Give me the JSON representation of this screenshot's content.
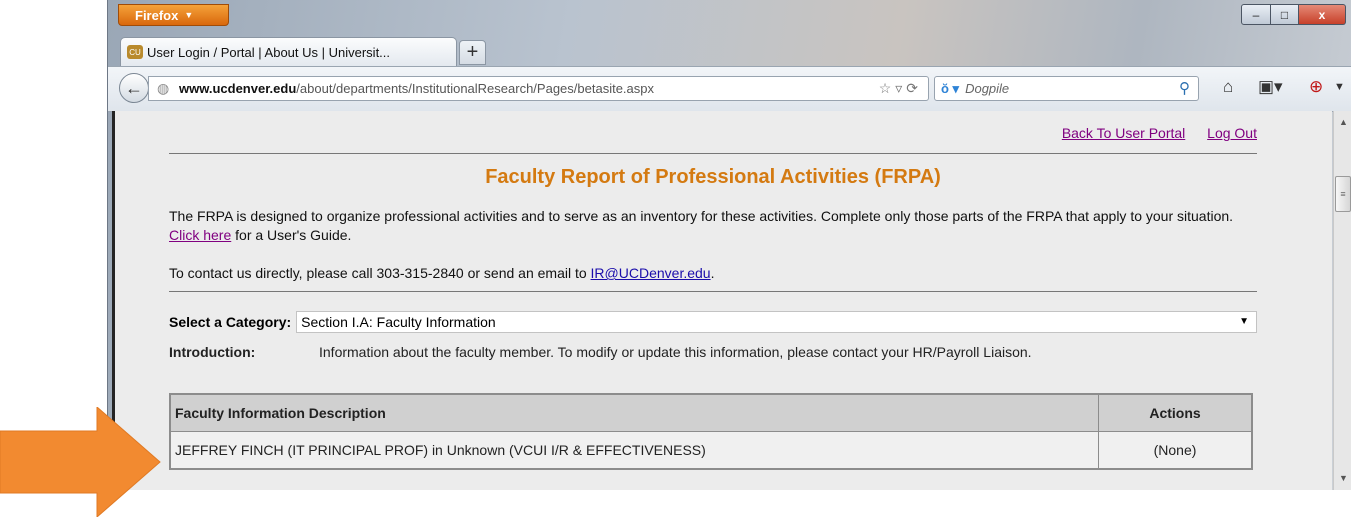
{
  "browser": {
    "menu_label": "Firefox",
    "tab_title": "User Login / Portal | About Us | Universit...",
    "new_tab": "+",
    "url_host": "www.ucdenver.edu",
    "url_path": "/about/departments/InstitutionalResearch/Pages/betasite.aspx",
    "search_engine": "Dogpile",
    "window_controls": {
      "minimize": "–",
      "maximize": "□",
      "close": "x"
    }
  },
  "page": {
    "back_to_portal": "Back To User Portal",
    "log_out": "Log Out",
    "title": "Faculty Report of Professional Activities (FRPA)",
    "intro_text": "The FRPA is designed to organize professional activities and to serve as an inventory for these activities.  Complete only those parts of the FRPA that apply to your situation.  ",
    "users_guide_link": "Click here",
    "users_guide_suffix": " for a User's Guide.",
    "contact_text": "To contact us directly, please call 303-315-2840 or send an email to ",
    "contact_email": "IR@UCDenver.edu",
    "contact_suffix": ".",
    "category_label": "Select a Category:",
    "category_value": "Section I.A: Faculty Information",
    "introduction_label": "Introduction:",
    "introduction_text": "Information about the faculty member. To modify or update this information, please contact your HR/Payroll Liaison.",
    "table": {
      "headers": [
        "Faculty Information Description",
        "Actions"
      ],
      "rows": [
        [
          "JEFFREY FINCH (IT PRINCIPAL PROF) in Unknown (VCUI I/R & EFFECTIVENESS)",
          "(None)"
        ]
      ]
    }
  },
  "annotation": {
    "arrow_color": "#f28a30"
  }
}
